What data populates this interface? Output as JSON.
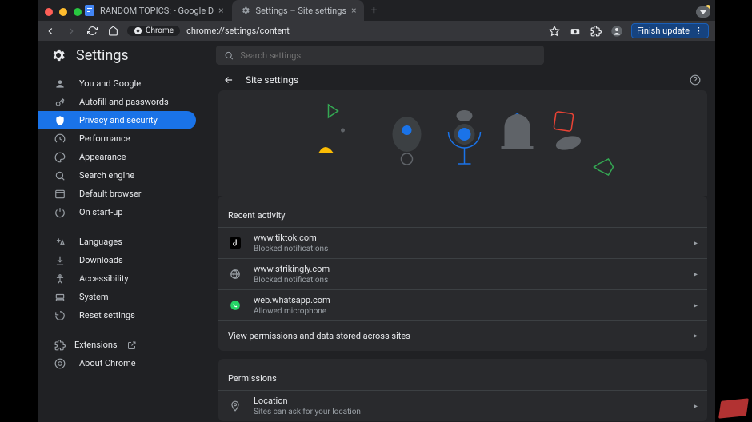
{
  "window": {
    "tabs": [
      {
        "title": "RANDOM TOPICS: - Google D",
        "favicon": "docs"
      },
      {
        "title": "Settings – Site settings",
        "favicon": "gear"
      }
    ]
  },
  "toolbar": {
    "chip_label": "Chrome",
    "url": "chrome://settings/content",
    "finish_update": "Finish update"
  },
  "app": {
    "title": "Settings",
    "search_placeholder": "Search settings"
  },
  "nav": {
    "items": [
      "You and Google",
      "Autofill and passwords",
      "Privacy and security",
      "Performance",
      "Appearance",
      "Search engine",
      "Default browser",
      "On start-up"
    ],
    "secondary": [
      "Languages",
      "Downloads",
      "Accessibility",
      "System",
      "Reset settings"
    ],
    "footer": [
      "Extensions",
      "About Chrome"
    ]
  },
  "page": {
    "header": "Site settings",
    "recent_title": "Recent activity",
    "recent": [
      {
        "site": "www.tiktok.com",
        "status": "Blocked notifications",
        "icon": "tiktok"
      },
      {
        "site": "www.strikingly.com",
        "status": "Blocked notifications",
        "icon": "generic"
      },
      {
        "site": "web.whatsapp.com",
        "status": "Allowed microphone",
        "icon": "whatsapp"
      }
    ],
    "view_all": "View permissions and data stored across sites",
    "permissions_title": "Permissions",
    "permissions": [
      {
        "title": "Location",
        "sub": "Sites can ask for your location"
      }
    ]
  }
}
